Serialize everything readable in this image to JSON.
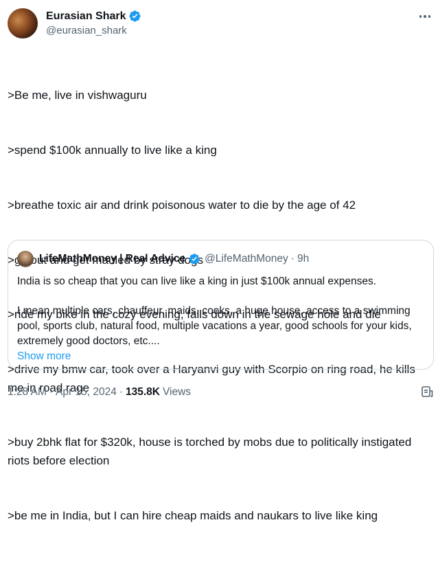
{
  "author": {
    "display_name": "Eurasian Shark",
    "handle": "@eurasian_shark",
    "verified": true
  },
  "tweet": {
    "lines": [
      ">Be me, live in vishwaguru",
      ">spend $100k annually to live like a king",
      ">breathe toxic air and drink poisonous water to die by the age of 42",
      ">go out and get mauled by stray dogs",
      ">ride my bike in the cozy evening, falls down in the sewage hole and die",
      ">drive my bmw car, took over a Haryanvi guy with Scorpio on ring road, he kills me in road rage",
      ">buy 2bhk flat for $320k, house is torched by mobs due to politically instigated riots before election",
      ">be me in India, but I can hire cheap maids and naukars to live like king"
    ]
  },
  "quoted": {
    "display_name": "LifeMathMoney | Real Advice",
    "handle": "@LifeMathMoney",
    "separator": "·",
    "time": "9h",
    "text_p1": "India is so cheap that you can live like a king in just $100k annual expenses.",
    "text_p2": "I mean multiple cars, chauffeur, maids, cooks, a huge house, access to a swimming pool, sports club, natural food, multiple vacations a year, good schools for your kids, extremely good doctors, etc....",
    "show_more": "Show more"
  },
  "meta": {
    "time": "1:28 AM",
    "separator": "·",
    "date": "Apr 15, 2024",
    "views_count": "135.8K",
    "views_label": "Views"
  },
  "colors": {
    "text": "#0f1419",
    "secondary": "#536471",
    "accent": "#1d9bf0",
    "border": "#cfd9de"
  },
  "icons": {
    "verified": "verified-badge-icon",
    "more": "more-horizontal-icon",
    "analytics": "view-analytics-icon"
  }
}
